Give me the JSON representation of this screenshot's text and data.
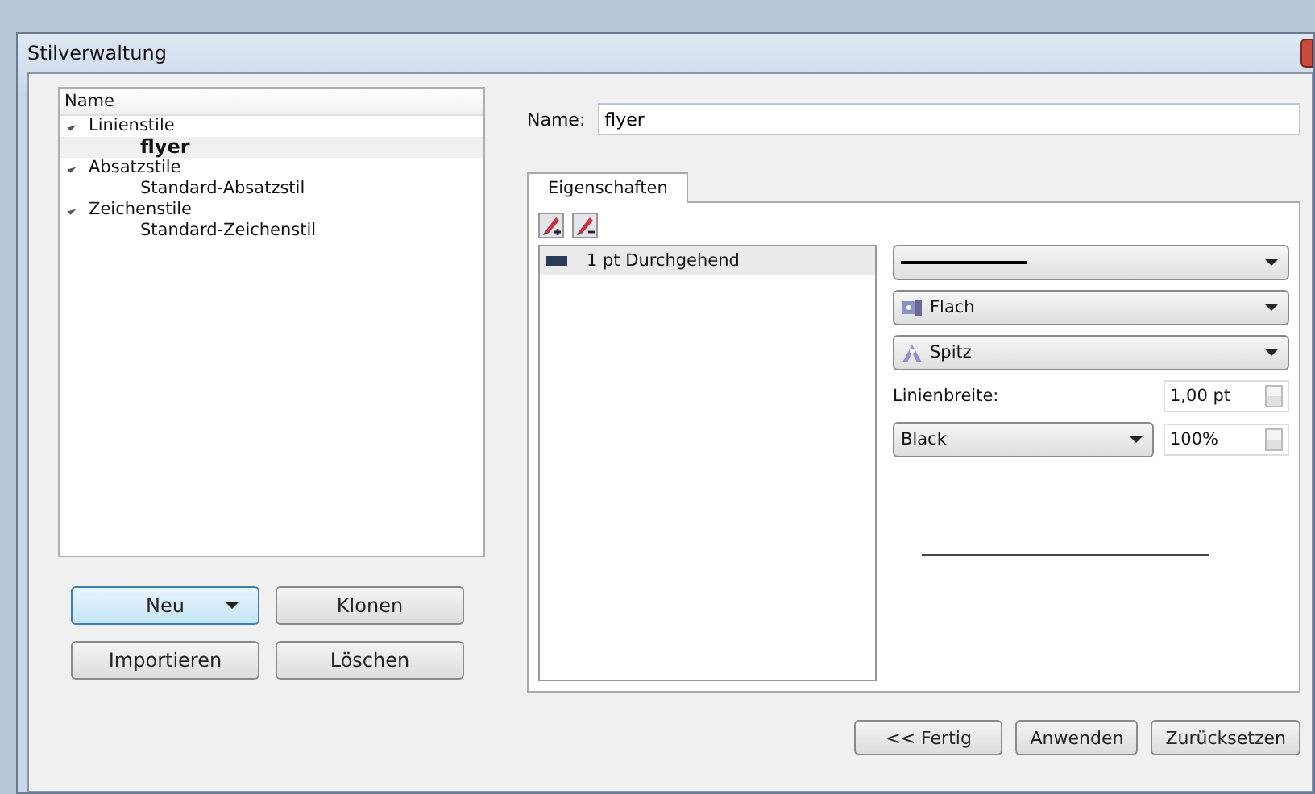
{
  "window": {
    "title": "Stilverwaltung"
  },
  "tree": {
    "header": "Name",
    "items": [
      {
        "label": "Linienstile",
        "expanded": true,
        "selected": false,
        "children": [
          {
            "label": "flyer",
            "selected": true
          }
        ]
      },
      {
        "label": "Absatzstile",
        "expanded": true,
        "selected": false,
        "children": [
          {
            "label": "Standard-Absatzstil",
            "selected": false
          }
        ]
      },
      {
        "label": "Zeichenstile",
        "expanded": true,
        "selected": false,
        "children": [
          {
            "label": "Standard-Zeichenstil",
            "selected": false
          }
        ]
      }
    ]
  },
  "left_buttons": [
    {
      "label": "Neu",
      "kind": "dropdown",
      "focused": true
    },
    {
      "label": "Klonen",
      "kind": "plain",
      "focused": false
    },
    {
      "label": "Importieren",
      "kind": "plain",
      "focused": false
    },
    {
      "label": "Löschen",
      "kind": "plain",
      "focused": false
    }
  ],
  "name_field": {
    "label": "Name:",
    "value": "flyer"
  },
  "tabs": [
    {
      "label": "Eigenschaften",
      "selected": true
    }
  ],
  "lines": [
    {
      "label": "1 pt Durchgehend",
      "selected": true
    }
  ],
  "end_cap": "Flach",
  "join": "Spitz",
  "line_width": {
    "label": "Linienbreite:",
    "value": "1,00 pt"
  },
  "fill_dropdown": {
    "value": "Black"
  },
  "opacity": "100%",
  "bottom_buttons": [
    "<< Fertig",
    "Anwenden",
    "Zurücksetzen"
  ]
}
